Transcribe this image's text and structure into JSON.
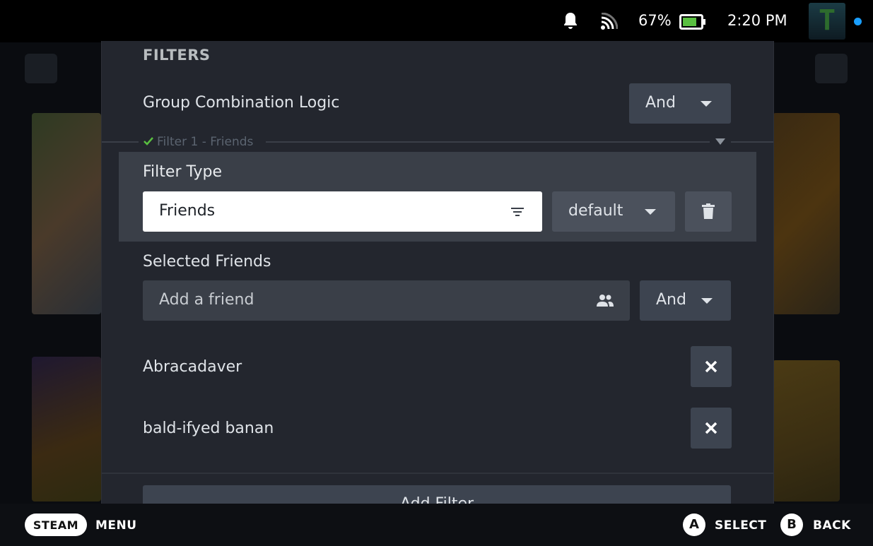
{
  "status_bar": {
    "battery_percent": "67%",
    "time": "2:20 PM",
    "avatar_letter": "T",
    "icons": [
      "bell-icon",
      "wifi-icon",
      "battery-icon"
    ]
  },
  "filters": {
    "title": "FILTERS",
    "group_logic_label": "Group Combination Logic",
    "group_logic_value": "And",
    "filter_header": "Filter 1 - Friends",
    "filter_type_label": "Filter Type",
    "filter_type_value": "Friends",
    "filter_mode_value": "default",
    "selected_friends_label": "Selected Friends",
    "add_friend_placeholder": "Add a friend",
    "friends_logic_value": "And",
    "friends": [
      {
        "name": "Abracadaver"
      },
      {
        "name": "bald-ifyed banan"
      }
    ],
    "add_filter_label": "Add Filter"
  },
  "footer": {
    "steam_label": "STEAM",
    "menu_label": "MENU",
    "a_key": "A",
    "select_label": "SELECT",
    "b_key": "B",
    "back_label": "BACK"
  },
  "colors": {
    "accent": "#1a9fff",
    "panel": "#23262e",
    "highlight_block": "#3a3f48",
    "check": "#59bf40"
  }
}
